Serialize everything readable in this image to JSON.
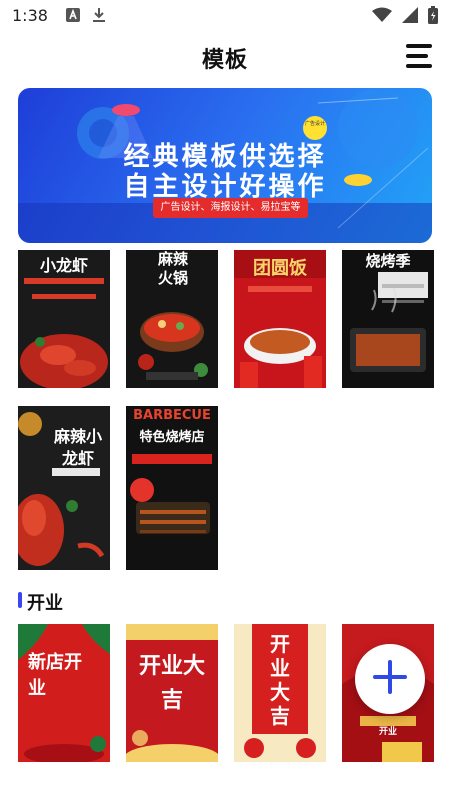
{
  "status_bar": {
    "time": "1:38",
    "icons": [
      "font-a-icon",
      "download-icon",
      "wifi-icon",
      "signal-icon",
      "battery-icon"
    ]
  },
  "header": {
    "title": "模板",
    "menu_icon": "hamburger-menu-icon"
  },
  "banner": {
    "line1": "经典模板供选择",
    "line2": "自主设计好操作",
    "subtitle": "广告设计、海报设计、易拉宝等",
    "badge_text": "广告设计"
  },
  "templates_row1": [
    {
      "title": "小龙虾",
      "color": "#1a1a1a",
      "accent": "#c8281e"
    },
    {
      "title": "麻辣火锅",
      "color": "#151515",
      "accent": "#e2352a"
    },
    {
      "title": "团圆饭",
      "color": "#c8151b",
      "accent": "#f5d15a"
    },
    {
      "title": "烧烤季",
      "color": "#101010",
      "accent": "#d8c7a0"
    }
  ],
  "templates_row2": [
    {
      "title": "麻辣小龙虾",
      "color": "#1d1d1d",
      "accent": "#d23a24"
    },
    {
      "title": "特色烧烤店",
      "subtitle": "BARBECUE",
      "color": "#111111",
      "accent": "#e4332a"
    }
  ],
  "section": {
    "title": "开业"
  },
  "templates_row3": [
    {
      "title": "新店开业",
      "color": "#d21d1d",
      "accent": "#1f7a3a"
    },
    {
      "title": "开业大吉",
      "color": "#c4191f",
      "accent": "#f4d06b"
    },
    {
      "title": "开业大吉",
      "color": "#f7e9c2",
      "accent": "#d61f1f"
    },
    {
      "title": "开业",
      "color": "#c51a1e",
      "accent": "#f2c84b"
    }
  ],
  "fab": {
    "icon": "plus-icon",
    "color": "#2f49e6"
  }
}
